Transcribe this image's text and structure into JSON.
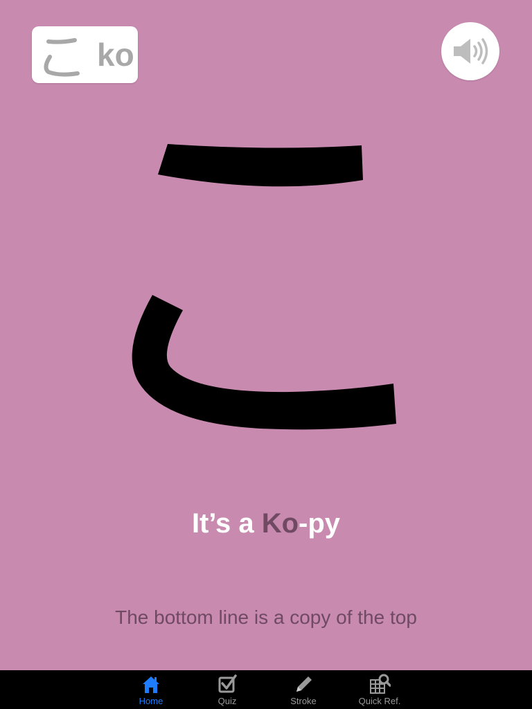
{
  "card": {
    "kana": "こ",
    "romaji": "ko"
  },
  "mnemonic": {
    "title_part1": "It’s a ",
    "title_highlight": "Ko",
    "title_part2": "-py",
    "hint": "The bottom line is a copy of the top"
  },
  "tabs": [
    {
      "label": "Home",
      "icon": "home-icon",
      "active": true
    },
    {
      "label": "Quiz",
      "icon": "checkbox-icon",
      "active": false
    },
    {
      "label": "Stroke",
      "icon": "pencil-icon",
      "active": false
    },
    {
      "label": "Quick Ref.",
      "icon": "grid-search-icon",
      "active": false
    }
  ],
  "colors": {
    "background": "#c98ab0",
    "highlight": "#6f4a62",
    "tab_active": "#1e7cff",
    "tab_inactive": "#9a9a9a"
  }
}
